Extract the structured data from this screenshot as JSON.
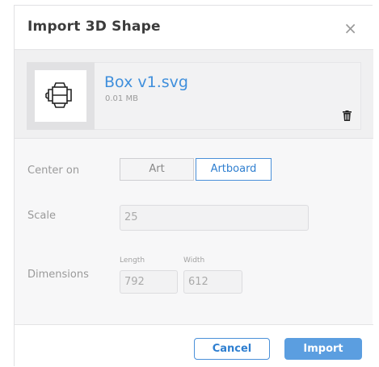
{
  "dialog": {
    "title": "Import 3D Shape",
    "close_glyph": "×"
  },
  "file": {
    "name": "Box v1.svg",
    "size": "0.01 MB",
    "thumbnail_icon": "box-dieline-icon",
    "delete_icon": "trash-icon"
  },
  "center_on": {
    "label": "Center on",
    "options": [
      "Art",
      "Artboard"
    ],
    "selected": "Artboard"
  },
  "scale": {
    "label": "Scale",
    "value": "25"
  },
  "dimensions": {
    "label": "Dimensions",
    "length_label": "Length",
    "length_value": "792",
    "width_label": "Width",
    "width_value": "612"
  },
  "footer": {
    "cancel_label": "Cancel",
    "import_label": "Import"
  },
  "colors": {
    "accent": "#4a90d9",
    "primary_button": "#5b9ee0",
    "file_name": "#3f8fdc"
  }
}
